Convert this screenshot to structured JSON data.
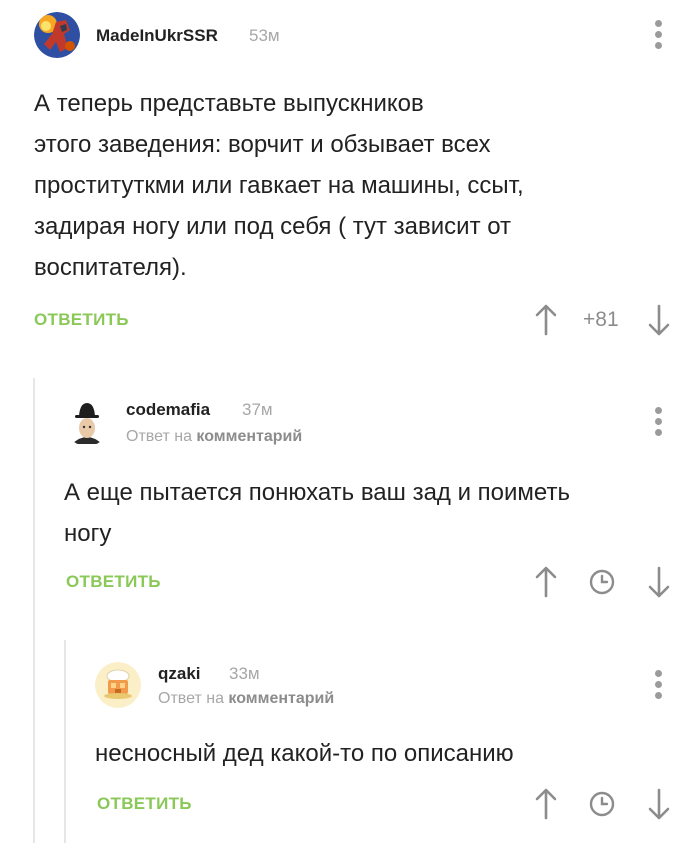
{
  "comments": [
    {
      "author": "MadeInUkrSSR",
      "time": "53м",
      "text": "А теперь представьте выпускников\nэтого заведения: ворчит и обзывает всех\nпроституткми или гавкает на машины, ссыт,\nзадирая ногу или под себя ( тут зависит от\nвоспитателя).",
      "reply_label": "ОТВЕТИТЬ",
      "rating": "+81"
    },
    {
      "author": "codemafia",
      "time": "37м",
      "reply_prefix": "Ответ на",
      "reply_target": "комментарий",
      "text": "А еще пытается понюхать ваш зад и поиметь\nногу",
      "reply_label": "ОТВЕТИТЬ"
    },
    {
      "author": "qzaki",
      "time": "33м",
      "reply_prefix": "Ответ на",
      "reply_target": "комментарий",
      "text": "несносный дед какой-то по описанию",
      "reply_label": "ОТВЕТИТЬ"
    }
  ],
  "colors": {
    "accent": "#8ac858",
    "muted": "#a7a7a7",
    "icon": "#8c8c8c"
  },
  "icons": {
    "upvote": "arrow-up-icon",
    "downvote": "arrow-down-icon",
    "pending": "clock-icon",
    "menu": "more-vertical-icon"
  }
}
